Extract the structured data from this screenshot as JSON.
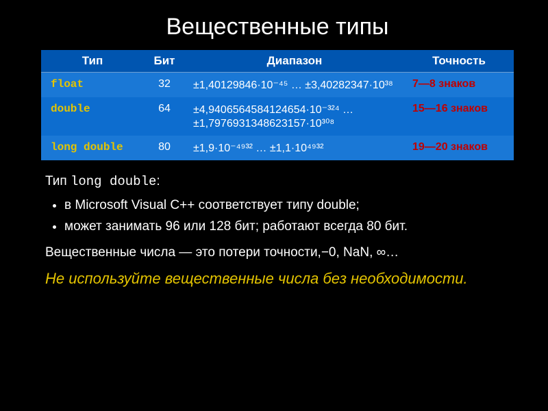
{
  "title": "Вещественные типы",
  "table": {
    "headers": [
      "Тип",
      "Бит",
      "Диапазон",
      "Точность"
    ],
    "rows": [
      {
        "name": "float",
        "bits": "32",
        "range": "±1,40129846·10⁻⁴⁵ … ±3,40282347·10³⁸",
        "precision": "7—8 знаков"
      },
      {
        "name": "double",
        "bits": "64",
        "range": "±4,9406564584124654·10⁻³²⁴ … ±1,7976931348623157·10³⁰⁸",
        "precision": "15—16 знаков"
      },
      {
        "name": "long double",
        "bits": "80",
        "range": "±1,9·10⁻⁴⁹³² … ±1,1·10⁴⁹³²",
        "precision": "19—20 знаков"
      }
    ]
  },
  "body": {
    "lead_prefix": "Тип ",
    "lead_code": "long double",
    "lead_suffix": ":",
    "bullets": [
      "в Microsoft Visual C++ соответствует типу double;",
      "может занимать 96 или 128 бит; работают всегда 80 бит."
    ],
    "para2": "Вещественные числа — это потери точности,−0, NaN, ∞…",
    "emph": "Не используйте вещественные числа без необходимости."
  },
  "chart_data": {
    "type": "table",
    "title": "Вещественные типы",
    "columns": [
      "Тип",
      "Бит",
      "Диапазон",
      "Точность"
    ],
    "rows": [
      [
        "float",
        32,
        "±1.40129846e-45 … ±3.40282347e38",
        "7—8 знаков"
      ],
      [
        "double",
        64,
        "±4.9406564584124654e-324 … ±1.7976931348623157e308",
        "15—16 знаков"
      ],
      [
        "long double",
        80,
        "±1.9e-4932 … ±1.1e4932",
        "19—20 знаков"
      ]
    ]
  }
}
